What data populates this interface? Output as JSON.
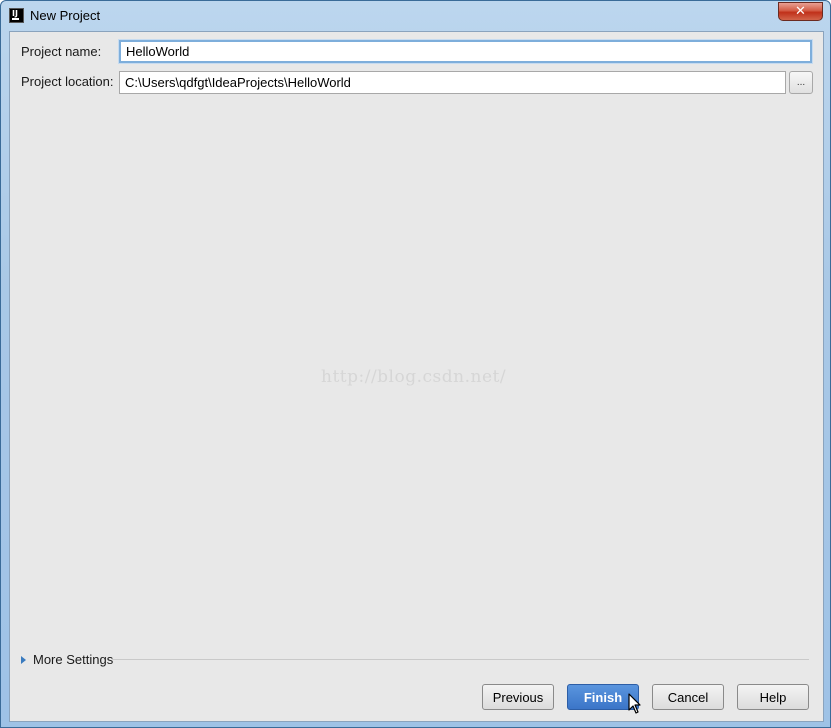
{
  "window": {
    "title": "New Project",
    "close_label": "✕"
  },
  "form": {
    "project_name_label": "Project name:",
    "project_name_value": "HelloWorld",
    "project_location_label": "Project location:",
    "project_location_value": "C:\\Users\\qdfgt\\IdeaProjects\\HelloWorld",
    "browse_label": "..."
  },
  "watermark": "http://blog.csdn.net/",
  "more_settings": {
    "label": "More Settings"
  },
  "buttons": {
    "previous": "Previous",
    "finish": "Finish",
    "cancel": "Cancel",
    "help": "Help"
  },
  "colors": {
    "primary_button": "#3b75c8",
    "dialog_background": "#e8e8e8",
    "focus_ring": "#7eaedb"
  },
  "icons": {
    "app": "intellij-idea-icon",
    "close": "close-icon",
    "expand": "triangle-right-icon",
    "cursor": "mouse-pointer-icon"
  }
}
